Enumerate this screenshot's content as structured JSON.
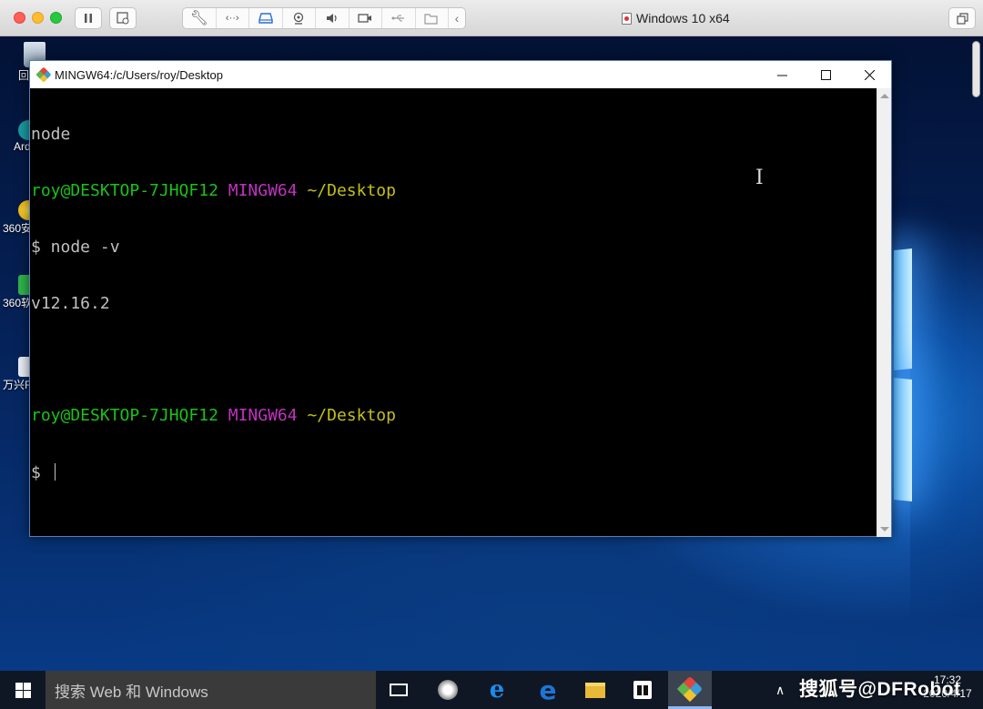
{
  "host": {
    "window_title": "Windows 10 x64"
  },
  "desktop": {
    "icons": [
      {
        "label": "回"
      },
      {
        "label": "Ard"
      },
      {
        "label": "360安"
      },
      {
        "label": "360软"
      },
      {
        "label": "万兴F"
      }
    ]
  },
  "terminal": {
    "title": "MINGW64:/c/Users/roy/Desktop",
    "lines": [
      {
        "text": "node"
      },
      {
        "user": "roy@DESKTOP-7JHQF12",
        "env": "MINGW64",
        "path": "~/Desktop"
      },
      {
        "text": "$ node -v"
      },
      {
        "text": "v12.16.2"
      },
      {
        "text": ""
      },
      {
        "user": "roy@DESKTOP-7JHQF12",
        "env": "MINGW64",
        "path": "~/Desktop"
      },
      {
        "text": "$ "
      }
    ]
  },
  "taskbar": {
    "search_placeholder": "搜索 Web 和 Windows",
    "clock_time": "17:32",
    "clock_date": "2020/4/17"
  },
  "watermark": "搜狐号@DFRobot",
  "colors": {
    "prompt_user": "#19c219",
    "prompt_env": "#c131c1",
    "prompt_path": "#c1c119",
    "terminal_bg": "#000000"
  }
}
